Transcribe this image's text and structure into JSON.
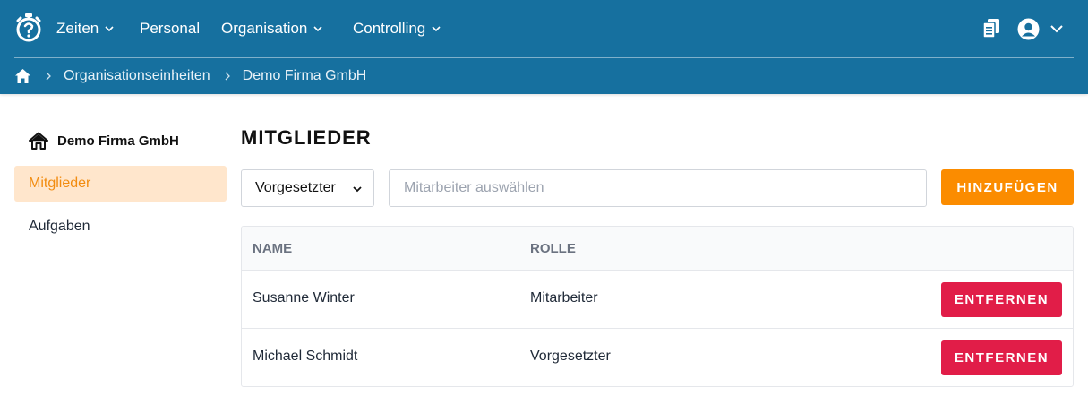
{
  "nav": {
    "items": [
      {
        "label": "Zeiten",
        "has_dropdown": true
      },
      {
        "label": "Personal",
        "has_dropdown": false
      },
      {
        "label": "Organisation",
        "has_dropdown": true
      },
      {
        "label": "Controlling",
        "has_dropdown": true
      }
    ],
    "icons": {
      "logo": "stopwatch-icon",
      "clipboard": "clipboard-icon",
      "user": "user-circle-icon",
      "user_chevron": "chevron-down-icon"
    }
  },
  "breadcrumb": {
    "home_icon": "home-icon",
    "items": [
      "Organisationseinheiten",
      "Demo Firma GmbH"
    ]
  },
  "sidebar": {
    "title": "Demo Firma GmbH",
    "title_icon": "home-icon",
    "items": [
      {
        "label": "Mitglieder",
        "active": true
      },
      {
        "label": "Aufgaben",
        "active": false
      }
    ]
  },
  "main": {
    "title": "MITGLIEDER",
    "role_select": {
      "value": "Vorgesetzter"
    },
    "employee_input": {
      "placeholder": "Mitarbeiter auswählen",
      "value": ""
    },
    "add_label": "HINZUFÜGEN",
    "table": {
      "headers": {
        "name": "NAME",
        "role": "ROLLE"
      },
      "rows": [
        {
          "name": "Susanne Winter",
          "role": "Mitarbeiter",
          "action": "ENTFERNEN"
        },
        {
          "name": "Michael Schmidt",
          "role": "Vorgesetzter",
          "action": "ENTFERNEN"
        }
      ]
    }
  },
  "colors": {
    "header_bg": "#16709f",
    "accent_orange": "#fb8c00",
    "active_bg": "#ffe6cc",
    "danger": "#e11d48"
  }
}
